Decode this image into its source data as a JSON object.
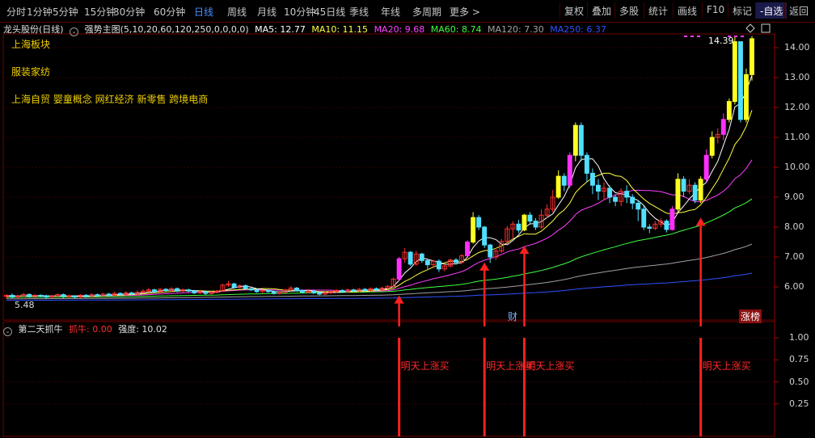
{
  "toolbar": {
    "periods": [
      "分时",
      "1分钟",
      "5分钟",
      "15分钟",
      "30分钟",
      "60分钟",
      "日线",
      "周线",
      "月线",
      "10分钟",
      "45日线",
      "季线",
      "年线",
      "多周期",
      "更多 >"
    ],
    "active_period": "日线",
    "right_buttons": [
      "复权",
      "叠加",
      "多股",
      "统计",
      "画线",
      "F10",
      "标记",
      "-自选",
      "返回"
    ]
  },
  "legend": {
    "stock": "龙头股份(日线)",
    "indicator": "强势主图(5,10,20,60,120,250,0,0,0,0)",
    "ma": [
      {
        "label": "MA5: 12.77",
        "color": "#ffffff"
      },
      {
        "label": "MA10: 11.15",
        "color": "#ffff40"
      },
      {
        "label": "MA20: 9.68",
        "color": "#ff40ff"
      },
      {
        "label": "MA60: 8.74",
        "color": "#40ff40"
      },
      {
        "label": "MA120: 7.30",
        "color": "#a0a0a0"
      },
      {
        "label": "MA250: 6.37",
        "color": "#3050ff"
      }
    ]
  },
  "sector": {
    "title": "上海板块",
    "industry": "服装家纺",
    "concepts": "上海自贸 婴童概念 网红经济 新零售 跨境电商"
  },
  "sub_legend": {
    "name": "第二天抓牛",
    "signal": "抓牛: 0.00",
    "strength": "强度: 10.02"
  },
  "annotations": {
    "high_price": "14.39",
    "low_price": "5.48",
    "cai": "财",
    "zhangbang": "涨榜",
    "signal_text": "明天上涨买"
  },
  "chart_data": {
    "type": "candlestick",
    "ylim": [
      5.2,
      14.6
    ],
    "yticks": [
      6,
      7,
      8,
      9,
      10,
      11,
      12,
      13,
      14
    ],
    "ytick_labels": [
      "6.00",
      "7.00",
      "8.00",
      "9.00",
      "10.00",
      "11.00",
      "12.00",
      "13.00",
      "14.00"
    ],
    "sub_yticks": [
      0.25,
      0.5,
      0.75,
      1.0
    ],
    "sub_ytick_labels": [
      "0.25",
      "0.50",
      "0.75",
      "1.00"
    ],
    "candles": [
      [
        5.68,
        5.72,
        5.6,
        5.75
      ],
      [
        5.72,
        5.66,
        5.62,
        5.78
      ],
      [
        5.66,
        5.7,
        5.6,
        5.74
      ],
      [
        5.7,
        5.75,
        5.65,
        5.8
      ],
      [
        5.75,
        5.68,
        5.64,
        5.78
      ],
      [
        5.68,
        5.72,
        5.62,
        5.76
      ],
      [
        5.72,
        5.7,
        5.65,
        5.75
      ],
      [
        5.7,
        5.66,
        5.6,
        5.74
      ],
      [
        5.66,
        5.7,
        5.62,
        5.74
      ],
      [
        5.7,
        5.74,
        5.66,
        5.78
      ],
      [
        5.74,
        5.68,
        5.62,
        5.78
      ],
      [
        5.68,
        5.7,
        5.63,
        5.74
      ],
      [
        5.7,
        5.66,
        5.6,
        5.72
      ],
      [
        5.66,
        5.72,
        5.62,
        5.76
      ],
      [
        5.72,
        5.68,
        5.64,
        5.76
      ],
      [
        5.68,
        5.74,
        5.64,
        5.78
      ],
      [
        5.74,
        5.7,
        5.66,
        5.78
      ],
      [
        5.7,
        5.76,
        5.68,
        5.8
      ],
      [
        5.76,
        5.72,
        5.68,
        5.8
      ],
      [
        5.72,
        5.78,
        5.7,
        5.84
      ],
      [
        5.78,
        5.74,
        5.7,
        5.82
      ],
      [
        5.74,
        5.8,
        5.72,
        5.86
      ],
      [
        5.8,
        5.76,
        5.72,
        5.84
      ],
      [
        5.76,
        5.82,
        5.72,
        5.88
      ],
      [
        5.82,
        5.86,
        5.78,
        5.92
      ],
      [
        5.86,
        5.9,
        5.8,
        5.96
      ],
      [
        5.9,
        5.84,
        5.8,
        5.94
      ],
      [
        5.84,
        5.92,
        5.8,
        5.96
      ],
      [
        5.92,
        5.88,
        5.84,
        5.96
      ],
      [
        5.88,
        5.94,
        5.84,
        5.98
      ],
      [
        5.94,
        5.86,
        5.82,
        5.98
      ],
      [
        5.86,
        5.9,
        5.82,
        5.94
      ],
      [
        5.9,
        5.86,
        5.82,
        5.94
      ],
      [
        5.86,
        5.8,
        5.76,
        5.9
      ],
      [
        5.8,
        5.84,
        5.76,
        5.88
      ],
      [
        5.84,
        5.78,
        5.74,
        5.88
      ],
      [
        5.78,
        5.82,
        5.74,
        5.86
      ],
      [
        5.82,
        5.86,
        5.78,
        5.9
      ],
      [
        5.86,
        6.06,
        5.84,
        6.1
      ],
      [
        6.06,
        6.1,
        6.0,
        6.2
      ],
      [
        6.1,
        5.98,
        5.94,
        6.14
      ],
      [
        5.98,
        6.04,
        5.94,
        6.08
      ],
      [
        6.04,
        5.94,
        5.9,
        6.08
      ],
      [
        5.94,
        5.9,
        5.86,
        5.98
      ],
      [
        5.9,
        5.84,
        5.8,
        5.94
      ],
      [
        5.84,
        5.88,
        5.8,
        5.92
      ],
      [
        5.88,
        5.84,
        5.8,
        5.92
      ],
      [
        5.84,
        5.78,
        5.74,
        5.88
      ],
      [
        5.78,
        5.82,
        5.74,
        5.86
      ],
      [
        5.82,
        5.9,
        5.78,
        5.94
      ],
      [
        5.9,
        5.96,
        5.86,
        6.02
      ],
      [
        5.96,
        5.88,
        5.84,
        6.0
      ],
      [
        5.88,
        5.82,
        5.78,
        5.92
      ],
      [
        5.82,
        5.86,
        5.78,
        5.9
      ],
      [
        5.86,
        5.8,
        5.76,
        5.9
      ],
      [
        5.8,
        5.76,
        5.72,
        5.84
      ],
      [
        5.76,
        5.8,
        5.72,
        5.84
      ],
      [
        5.8,
        5.84,
        5.76,
        5.88
      ],
      [
        5.84,
        5.88,
        5.8,
        5.92
      ],
      [
        5.88,
        5.84,
        5.8,
        5.92
      ],
      [
        5.84,
        5.9,
        5.8,
        5.94
      ],
      [
        5.9,
        5.86,
        5.82,
        5.94
      ],
      [
        5.86,
        5.92,
        5.82,
        5.96
      ],
      [
        5.92,
        5.88,
        5.84,
        5.96
      ],
      [
        5.88,
        5.94,
        5.84,
        5.98
      ],
      [
        5.94,
        5.9,
        5.86,
        5.98
      ],
      [
        5.9,
        5.96,
        5.86,
        6.0
      ],
      [
        5.96,
        6.02,
        5.92,
        6.06
      ],
      [
        6.02,
        6.26,
        5.98,
        6.3
      ],
      [
        6.26,
        6.94,
        6.2,
        7.0
      ],
      [
        6.94,
        7.16,
        6.8,
        7.3
      ],
      [
        7.16,
        6.76,
        6.7,
        7.2
      ],
      [
        6.76,
        7.1,
        6.7,
        7.2
      ],
      [
        7.1,
        6.88,
        6.8,
        7.14
      ],
      [
        6.88,
        6.74,
        6.6,
        6.92
      ],
      [
        6.74,
        6.86,
        6.62,
        6.9
      ],
      [
        6.86,
        6.6,
        6.5,
        6.92
      ],
      [
        6.6,
        6.7,
        6.52,
        6.76
      ],
      [
        6.7,
        6.9,
        6.64,
        6.94
      ],
      [
        6.9,
        6.82,
        6.74,
        6.96
      ],
      [
        6.82,
        7.04,
        6.76,
        7.1
      ],
      [
        7.04,
        7.5,
        7.0,
        7.56
      ],
      [
        7.5,
        8.32,
        7.44,
        8.5
      ],
      [
        8.32,
        8.0,
        7.9,
        8.4
      ],
      [
        8.0,
        7.4,
        7.3,
        8.04
      ],
      [
        7.4,
        7.0,
        6.8,
        7.44
      ],
      [
        7.0,
        7.2,
        6.9,
        7.3
      ],
      [
        7.2,
        7.52,
        7.14,
        7.6
      ],
      [
        7.52,
        7.94,
        7.44,
        8.04
      ],
      [
        7.94,
        8.1,
        7.6,
        8.2
      ],
      [
        8.1,
        7.9,
        7.8,
        8.24
      ],
      [
        7.9,
        8.4,
        7.86,
        8.44
      ],
      [
        8.4,
        8.2,
        8.08,
        8.5
      ],
      [
        8.2,
        8.0,
        7.9,
        8.3
      ],
      [
        8.0,
        8.4,
        7.94,
        8.6
      ],
      [
        8.4,
        8.6,
        8.3,
        8.76
      ],
      [
        8.6,
        9.0,
        8.5,
        9.24
      ],
      [
        9.0,
        9.7,
        8.94,
        9.9
      ],
      [
        9.7,
        9.4,
        9.2,
        9.8
      ],
      [
        9.4,
        10.4,
        9.3,
        10.5
      ],
      [
        10.4,
        11.4,
        10.2,
        11.5
      ],
      [
        11.4,
        10.4,
        10.2,
        11.5
      ],
      [
        10.4,
        9.8,
        9.5,
        10.5
      ],
      [
        9.8,
        9.4,
        9.1,
        9.96
      ],
      [
        9.4,
        9.2,
        8.9,
        9.6
      ],
      [
        9.2,
        9.3,
        8.9,
        9.5
      ],
      [
        9.3,
        9.0,
        8.8,
        9.4
      ],
      [
        9.0,
        8.86,
        8.7,
        9.1
      ],
      [
        8.86,
        9.2,
        8.7,
        9.3
      ],
      [
        9.2,
        9.0,
        8.8,
        9.4
      ],
      [
        9.0,
        8.8,
        8.6,
        9.1
      ],
      [
        8.8,
        8.6,
        8.2,
        8.9
      ],
      [
        8.6,
        8.0,
        7.9,
        8.7
      ],
      [
        8.0,
        7.96,
        7.8,
        8.1
      ],
      [
        7.96,
        8.1,
        7.9,
        8.2
      ],
      [
        8.1,
        8.2,
        8.0,
        8.3
      ],
      [
        8.2,
        7.92,
        7.82,
        8.26
      ],
      [
        7.92,
        8.6,
        7.88,
        8.7
      ],
      [
        8.6,
        9.6,
        8.5,
        9.8
      ],
      [
        9.6,
        9.2,
        9.0,
        9.7
      ],
      [
        9.2,
        9.4,
        9.1,
        9.6
      ],
      [
        9.4,
        8.9,
        8.8,
        9.5
      ],
      [
        8.9,
        9.6,
        8.8,
        9.7
      ],
      [
        9.6,
        10.4,
        9.5,
        10.6
      ],
      [
        10.4,
        11.0,
        10.3,
        11.2
      ],
      [
        11.0,
        11.1,
        10.8,
        11.3
      ],
      [
        11.1,
        11.6,
        10.9,
        11.8
      ],
      [
        11.6,
        12.2,
        11.5,
        12.3
      ],
      [
        12.2,
        14.2,
        12.1,
        14.39
      ],
      [
        14.2,
        11.6,
        11.5,
        14.1
      ],
      [
        11.6,
        13.1,
        11.5,
        13.3
      ],
      [
        13.1,
        14.3,
        12.9,
        14.39
      ]
    ],
    "signal_indices": [
      69,
      84,
      91,
      122
    ]
  }
}
